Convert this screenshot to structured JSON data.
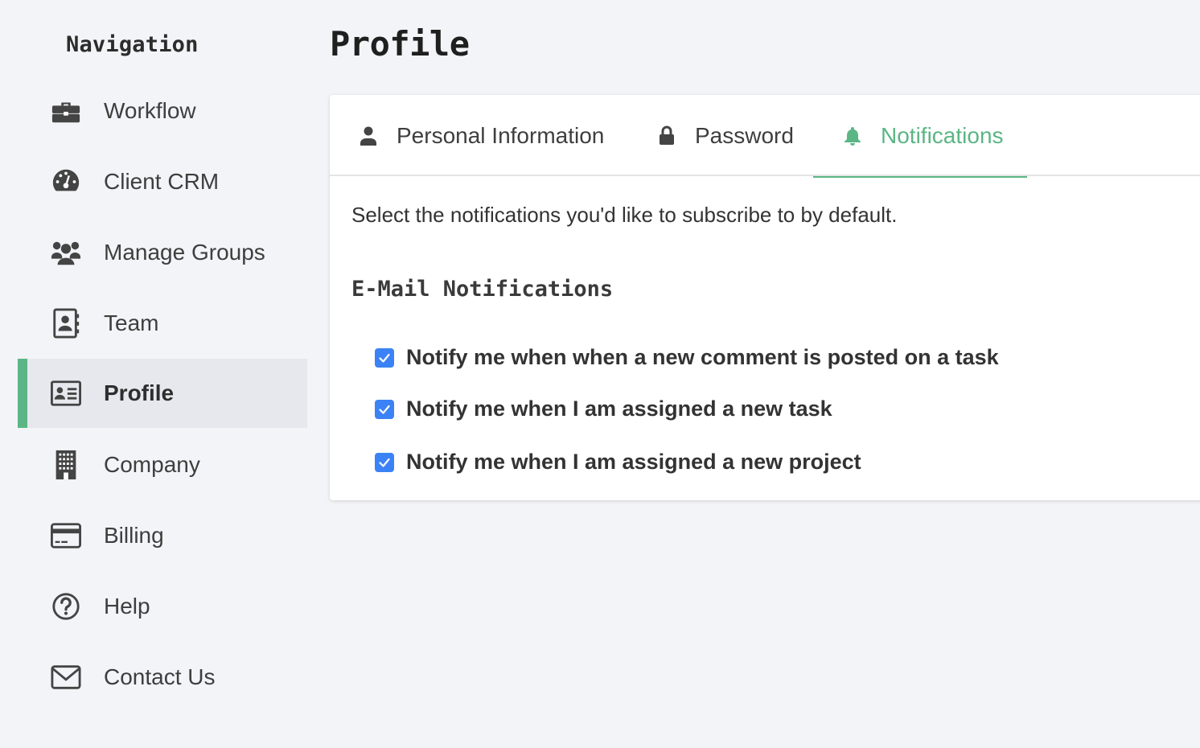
{
  "sidebar": {
    "heading": "Navigation",
    "items": [
      {
        "label": "Workflow",
        "icon": "briefcase-icon"
      },
      {
        "label": "Client CRM",
        "icon": "dashboard-icon"
      },
      {
        "label": "Manage Groups",
        "icon": "users-icon"
      },
      {
        "label": "Team",
        "icon": "address-book-icon"
      },
      {
        "label": "Profile",
        "icon": "id-card-icon",
        "active": true
      },
      {
        "label": "Company",
        "icon": "building-icon"
      },
      {
        "label": "Billing",
        "icon": "credit-card-icon"
      },
      {
        "label": "Help",
        "icon": "question-circle-icon"
      },
      {
        "label": "Contact Us",
        "icon": "envelope-icon"
      }
    ]
  },
  "main": {
    "title": "Profile",
    "tabs": [
      {
        "label": "Personal Information",
        "icon": "user-icon"
      },
      {
        "label": "Password",
        "icon": "lock-icon"
      },
      {
        "label": "Notifications",
        "icon": "bell-icon",
        "active": true
      }
    ],
    "intro": "Select the notifications you'd like to subscribe to by default.",
    "section_heading": "E-Mail Notifications",
    "options": [
      {
        "label": "Notify me when when a new comment is posted on a task",
        "checked": true
      },
      {
        "label": "Notify me when I am assigned a new task",
        "checked": true
      },
      {
        "label": "Notify me when I am assigned a new project",
        "checked": true
      }
    ]
  },
  "colors": {
    "accent": "#5bb584",
    "checkbox": "#3b82f6",
    "background": "#f3f4f7",
    "active_nav_bg": "#e6e8ed"
  }
}
